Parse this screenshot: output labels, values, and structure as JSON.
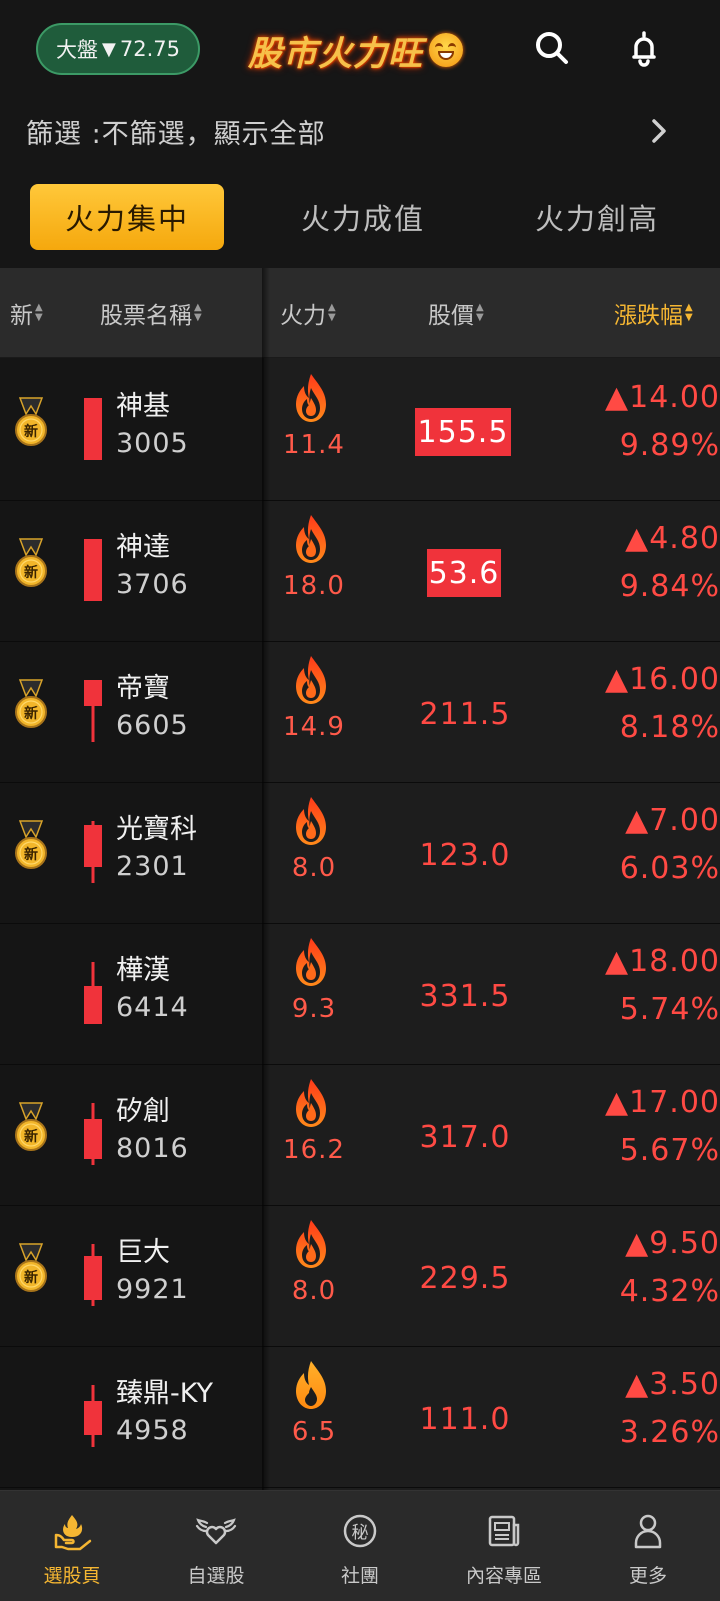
{
  "header": {
    "market_label": "大盤",
    "market_change": "72.75",
    "app_title": "股市火力旺",
    "search_icon": "search-icon",
    "bell_icon": "bell-icon"
  },
  "filter": {
    "label": "篩選 :不篩選，顯示全部"
  },
  "tabs": [
    {
      "label": "火力集中",
      "active": true
    },
    {
      "label": "火力成值",
      "active": false
    },
    {
      "label": "火力創高",
      "active": false
    }
  ],
  "columns": {
    "new": "新",
    "name": "股票名稱",
    "fire": "火力",
    "price": "股價",
    "change": "漲跌幅"
  },
  "colors": {
    "accent": "#f5b632",
    "up_red": "#ff4a44",
    "highlight_red": "#f0333b",
    "market_green": "#1f5c3b"
  },
  "rows": [
    {
      "new": true,
      "name": "神基",
      "code": "3005",
      "fire": "11.4",
      "price": "155.5",
      "price_hl": true,
      "chg": "▲14.00",
      "pct": "9.89%"
    },
    {
      "new": true,
      "name": "神達",
      "code": "3706",
      "fire": "18.0",
      "price": "53.6",
      "price_hl": true,
      "chg": "▲4.80",
      "pct": "9.84%"
    },
    {
      "new": true,
      "name": "帝寶",
      "code": "6605",
      "fire": "14.9",
      "price": "211.5",
      "price_hl": false,
      "chg": "▲16.00",
      "pct": "8.18%"
    },
    {
      "new": true,
      "name": "光寶科",
      "code": "2301",
      "fire": "8.0",
      "price": "123.0",
      "price_hl": false,
      "chg": "▲7.00",
      "pct": "6.03%"
    },
    {
      "new": false,
      "name": "樺漢",
      "code": "6414",
      "fire": "9.3",
      "price": "331.5",
      "price_hl": false,
      "chg": "▲18.00",
      "pct": "5.74%"
    },
    {
      "new": true,
      "name": "矽創",
      "code": "8016",
      "fire": "16.2",
      "price": "317.0",
      "price_hl": false,
      "chg": "▲17.00",
      "pct": "5.67%"
    },
    {
      "new": true,
      "name": "巨大",
      "code": "9921",
      "fire": "8.0",
      "price": "229.5",
      "price_hl": false,
      "chg": "▲9.50",
      "pct": "4.32%"
    },
    {
      "new": false,
      "name": "臻鼎-KY",
      "code": "4958",
      "fire": "6.5",
      "price": "111.0",
      "price_hl": false,
      "chg": "▲3.50",
      "pct": "3.26%"
    }
  ],
  "medal_text": "新",
  "nav": [
    {
      "label": "選股頁",
      "icon": "stock-pick-icon",
      "active": true
    },
    {
      "label": "自選股",
      "icon": "winged-heart-icon",
      "active": false
    },
    {
      "label": "社團",
      "icon": "secret-club-icon",
      "active": false
    },
    {
      "label": "內容專區",
      "icon": "news-icon",
      "active": false
    },
    {
      "label": "更多",
      "icon": "person-icon",
      "active": false
    }
  ],
  "nav_secret_glyph": "秘"
}
